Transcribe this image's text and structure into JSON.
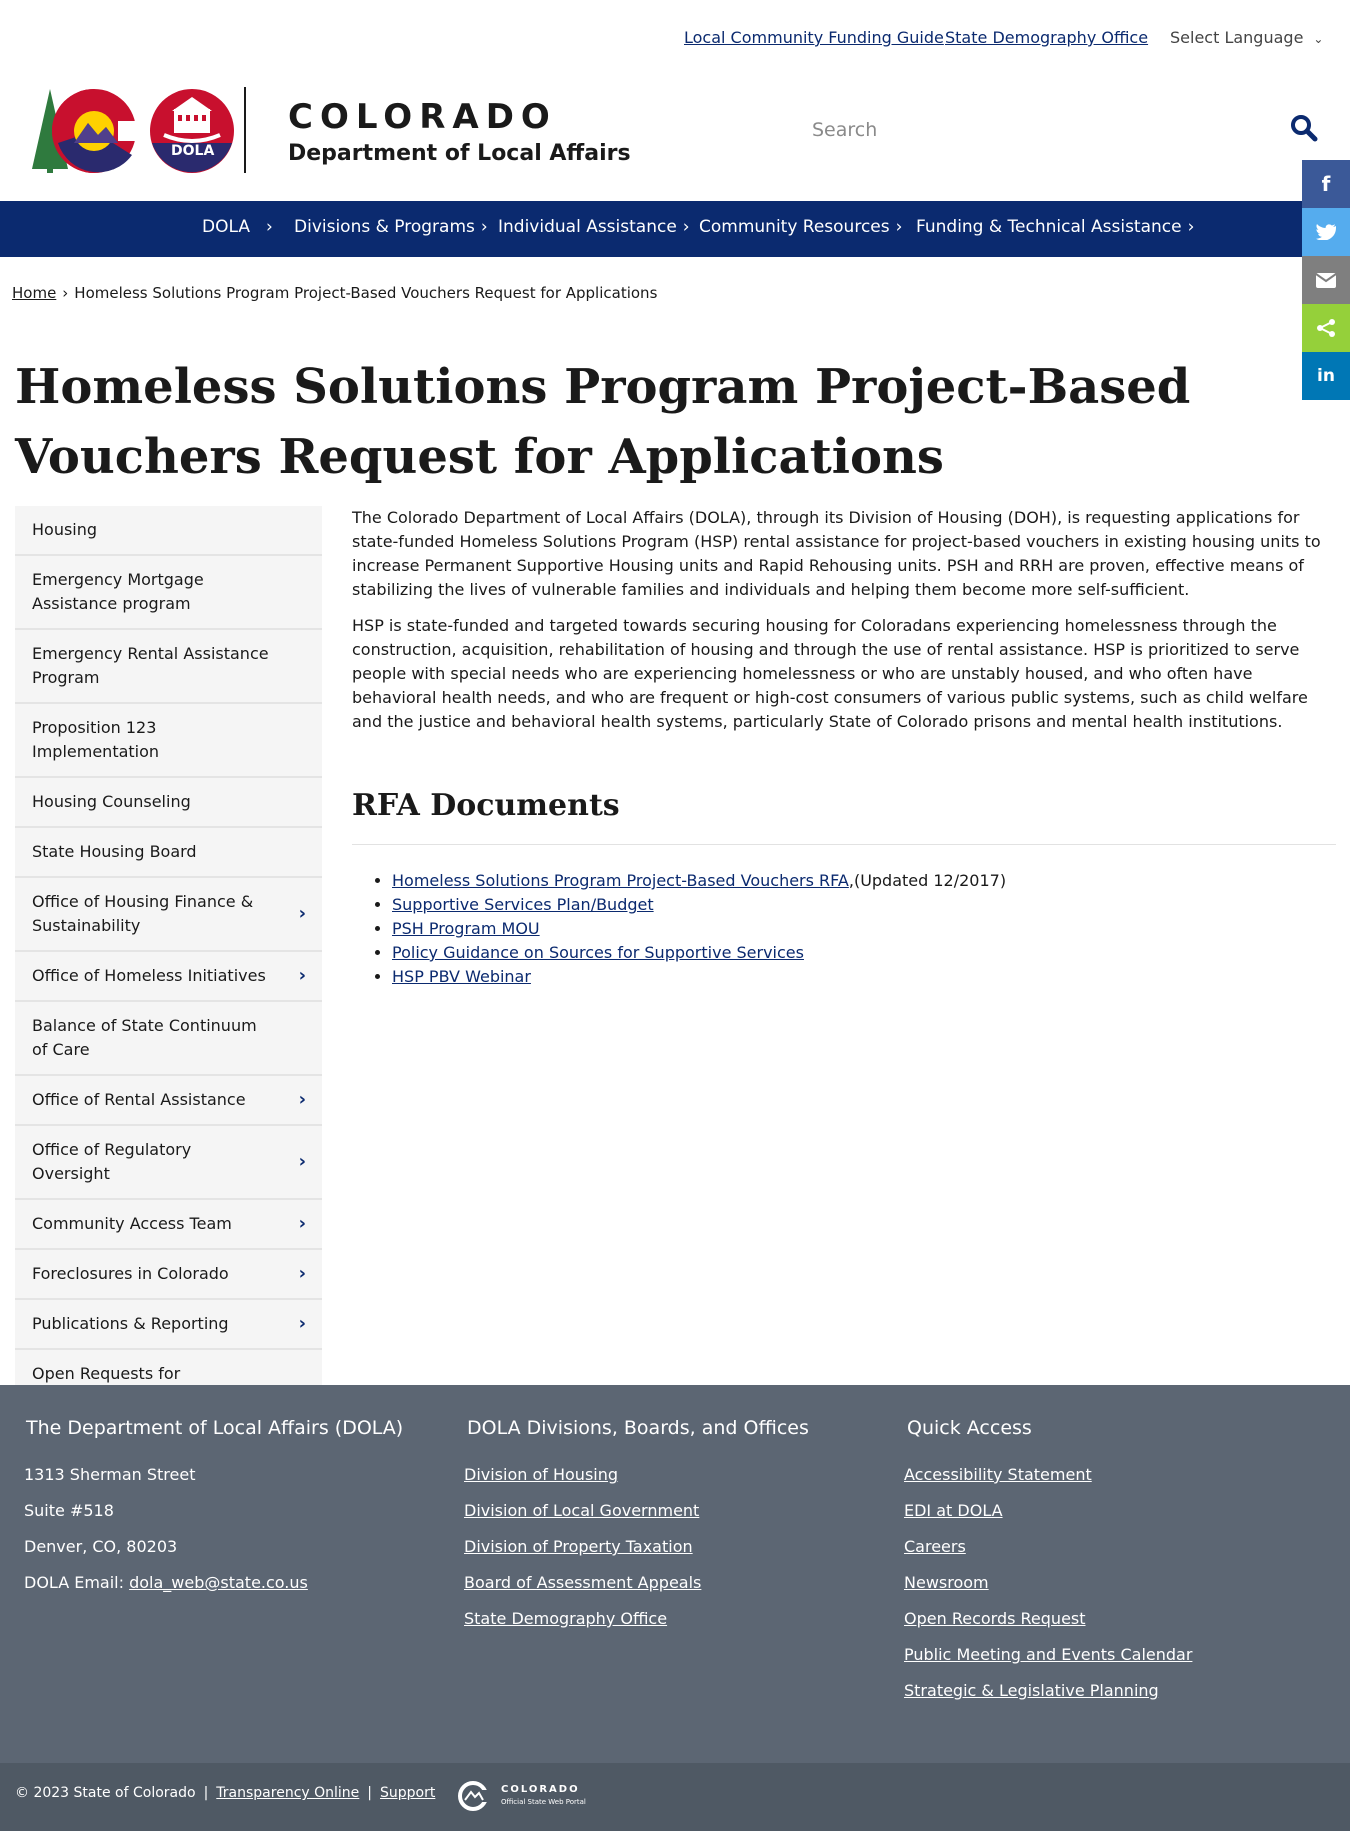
{
  "utility": {
    "link1": "Local Community Funding Guide",
    "link2": "State Demography Office",
    "language": "Select Language"
  },
  "header": {
    "wordmark": "COLORADO",
    "department": "Department of Local Affairs",
    "dola_badge": "DOLA",
    "search_placeholder": "Search"
  },
  "nav": {
    "items": [
      {
        "label": "DOLA"
      },
      {
        "label": "Divisions & Programs"
      },
      {
        "label": "Individual Assistance"
      },
      {
        "label": "Community Resources"
      },
      {
        "label": "Funding & Technical Assistance"
      }
    ]
  },
  "share": {
    "icons": [
      "facebook-icon",
      "twitter-icon",
      "email-icon",
      "share-icon",
      "linkedin-icon"
    ],
    "colors": [
      "#3b5998",
      "#55acee",
      "#7f7f7f",
      "#95d03a",
      "#0077b5"
    ],
    "linkedin_text": "in"
  },
  "breadcrumb": {
    "home": "Home",
    "current": "Homeless Solutions Program Project-Based Vouchers Request for Applications"
  },
  "page": {
    "title": "Homeless Solutions Program Project-Based Vouchers Request for Applications",
    "paragraph1": "The Colorado Department of Local Affairs (DOLA), through its Division of Housing (DOH), is requesting applications for state-funded Homeless Solutions Program (HSP) rental assistance for project-based vouchers in existing housing units to increase Permanent Supportive Housing units and Rapid Rehousing units. PSH and RRH are proven, effective means of stabilizing the lives of vulnerable families and individuals and helping them become more self-sufficient.",
    "paragraph2": "HSP is state-funded and targeted towards securing housing for Coloradans experiencing homelessness through the construction, acquisition, rehabilitation of housing and through the use of rental assistance. HSP is prioritized to serve people with special needs who are experiencing homelessness or who are unstably housed, and who often have behavioral health needs, and who are frequent or high-cost consumers of various public systems, such as child welfare and the justice and behavioral health systems, particularly State of Colorado prisons and mental health institutions.",
    "rfa_heading": "RFA Documents",
    "docs": [
      {
        "label": "Homeless Solutions Program Project-Based Vouchers RFA",
        "note": ",(Updated 12/2017)"
      },
      {
        "label": "Supportive Services Plan/Budget",
        "note": ""
      },
      {
        "label": "PSH Program MOU",
        "note": ""
      },
      {
        "label": "Policy Guidance on Sources for Supportive Services",
        "note": ""
      },
      {
        "label": "HSP PBV Webinar",
        "note": ""
      }
    ]
  },
  "sidenav": {
    "items": [
      {
        "label": "Housing"
      },
      {
        "label": "Emergency Mortgage Assistance program"
      },
      {
        "label": "Emergency Rental Assistance Program"
      },
      {
        "label": "Proposition 123 Implementation"
      },
      {
        "label": "Housing Counseling"
      },
      {
        "label": "State Housing Board"
      },
      {
        "label": "Office of Housing Finance & Sustainability"
      },
      {
        "label": "Office of Homeless Initiatives"
      },
      {
        "label": "Balance of State Continuum of Care"
      },
      {
        "label": "Office of Rental Assistance"
      },
      {
        "label": "Office of Regulatory Oversight"
      },
      {
        "label": "Community Access Team"
      },
      {
        "label": "Foreclosures in Colorado"
      },
      {
        "label": "Publications & Reporting"
      },
      {
        "label": "Open Requests for Applications (RFAs) / Notice of Funding Availabilities (NOFA)"
      }
    ]
  },
  "footer": {
    "col1": {
      "heading": "The Department of Local Affairs (DOLA)",
      "address1": "1313 Sherman Street",
      "address2": "Suite  #518",
      "address3": "Denver, CO, 80203",
      "email_label": "DOLA Email: ",
      "email": "dola_web@state.co.us"
    },
    "col2": {
      "heading": "DOLA Divisions, Boards, and Offices",
      "links": [
        "Division of Housing",
        "Division of Local Government",
        "Division of Property Taxation",
        "Board of Assessment Appeals",
        "State Demography Office"
      ]
    },
    "col3": {
      "heading": "Quick Access",
      "links": [
        "Accessibility Statement",
        "EDI at DOLA",
        "Careers",
        "Newsroom",
        "Open Records Request",
        "Public Meeting and Events Calendar",
        "Strategic & Legislative Planning"
      ]
    }
  },
  "subfooter": {
    "copyright": "© 2023 State of Colorado",
    "transparency": "Transparency Online",
    "support": "Support",
    "portal_name": "COLORADO",
    "portal_sub": "Official State Web Portal"
  },
  "colors": {
    "nav_blue": "#0b2a6f",
    "footer_gray": "#5c6673",
    "subfooter_gray": "#4f5964"
  }
}
